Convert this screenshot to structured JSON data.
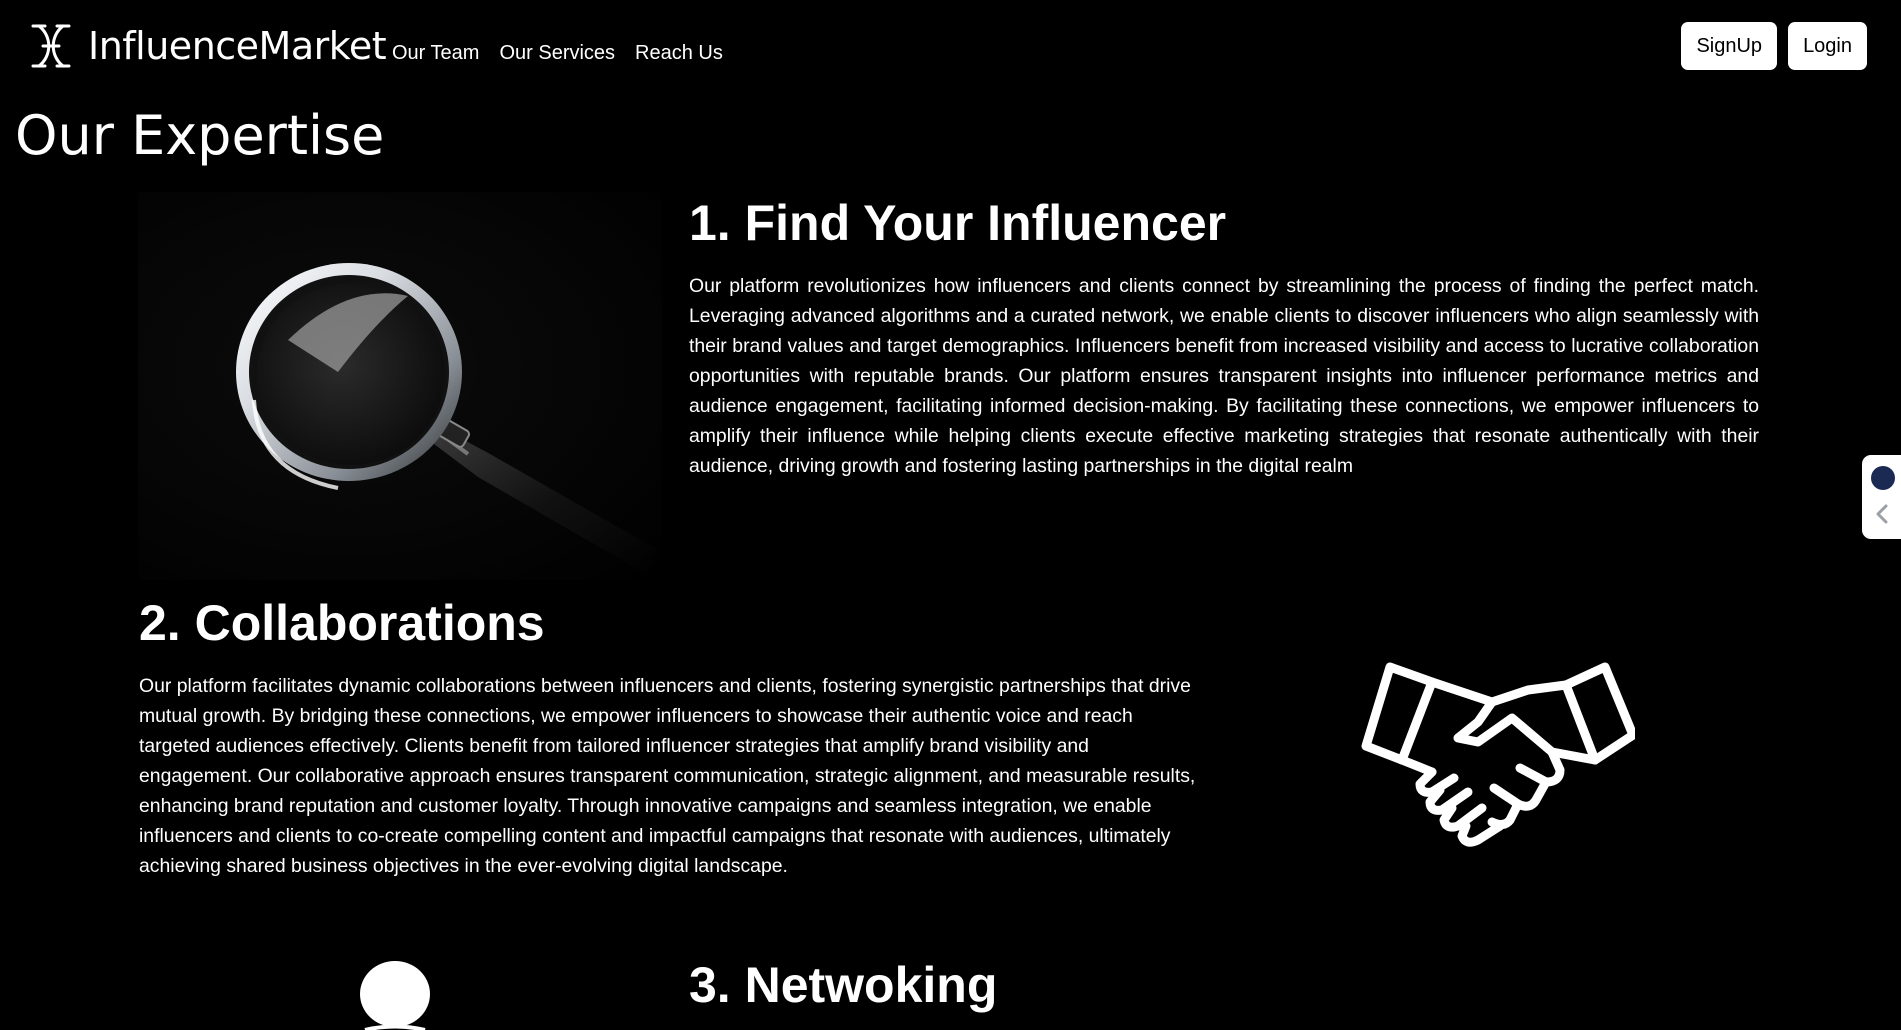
{
  "brand": {
    "name": "InfluenceMarket",
    "icon": "brand-logo-icon"
  },
  "nav": {
    "links": [
      "Our Team",
      "Our Services",
      "Reach Us"
    ]
  },
  "auth": {
    "signup_label": "SignUp",
    "login_label": "Login"
  },
  "page": {
    "title": "Our Expertise"
  },
  "sections": [
    {
      "title": "1. Find Your Influencer",
      "text": "Our platform revolutionizes how influencers and clients connect by streamlining the process of finding the perfect match. Leveraging advanced algorithms and a curated network, we enable clients to discover influencers who align seamlessly with their brand values and target demographics. Influencers benefit from increased visibility and access to lucrative collaboration opportunities with reputable brands. Our platform ensures transparent insights into influencer performance metrics and audience engagement, facilitating informed decision-making. By facilitating these connections, we empower influencers to amplify their influence while helping clients execute effective marketing strategies that resonate authentically with their audience, driving growth and fostering lasting partnerships in the digital realm",
      "image_icon": "magnifying-glass-icon"
    },
    {
      "title": "2. Collaborations",
      "text": "Our platform facilitates dynamic collaborations between influencers and clients, fostering synergistic partnerships that drive mutual growth. By bridging these connections, we empower influencers to showcase their authentic voice and reach targeted audiences effectively. Clients benefit from tailored influencer strategies that amplify brand visibility and engagement. Our collaborative approach ensures transparent communication, strategic alignment, and measurable results, enhancing brand reputation and customer loyalty. Through innovative campaigns and seamless integration, we enable influencers and clients to co-create compelling content and impactful campaigns that resonate with audiences, ultimately achieving shared business objectives in the ever-evolving digital landscape.",
      "image_icon": "handshake-icon"
    },
    {
      "title": "3. Netwoking",
      "image_icon": "network-person-icon"
    }
  ],
  "side_widget": {
    "icons": [
      "widget-avatar-icon",
      "chevron-left-icon"
    ]
  },
  "colors": {
    "background": "#000000",
    "text": "#ffffff",
    "button_bg": "#ffffff",
    "button_text": "#000000",
    "widget_dot": "#1b2a52"
  }
}
